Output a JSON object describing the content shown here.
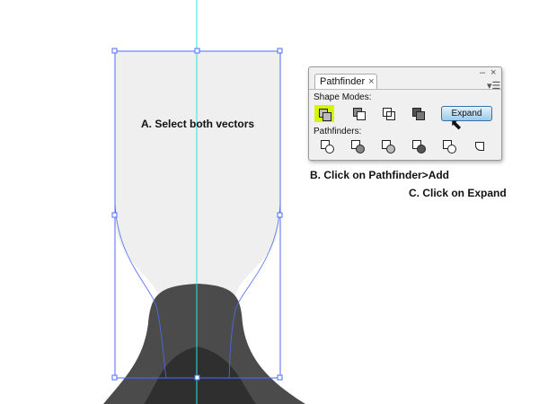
{
  "labels": {
    "a": "A. Select both vectors",
    "b": "B. Click on Pathfinder>Add",
    "c": "C. Click on Expand"
  },
  "panel": {
    "title": "Pathfinder",
    "close": "×",
    "minimize": "–",
    "window_close": "×",
    "shape_modes": "Shape Modes:",
    "pathfinders": "Pathfinders:",
    "expand": "Expand"
  },
  "colors": {
    "selection": "#4d6cf5",
    "guide": "#2ee6e6",
    "highlight": "#d6f500"
  }
}
